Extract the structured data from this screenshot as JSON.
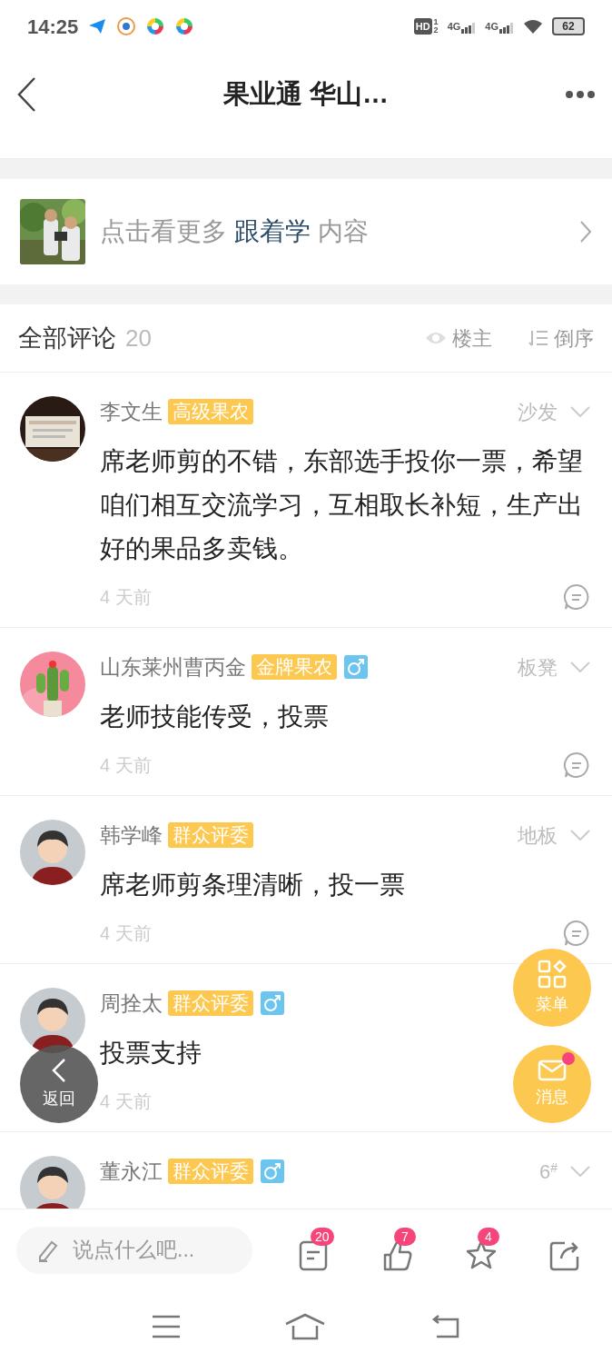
{
  "status_bar": {
    "time": "14:25",
    "hd": {
      "label": "HD",
      "sims": [
        "1",
        "2"
      ]
    },
    "networks": [
      "4G",
      "4G"
    ],
    "battery": "62"
  },
  "nav": {
    "title": "果业通 华山…"
  },
  "promo": {
    "prefix": "点击看更多",
    "highlight": "跟着学",
    "suffix": "内容"
  },
  "comments_header": {
    "title": "全部评论",
    "count": "20",
    "filters": [
      {
        "kind": "eye",
        "label": "楼主"
      },
      {
        "kind": "sort",
        "label": "倒序"
      }
    ]
  },
  "comments": [
    {
      "name": "李文生",
      "badge": "高级果农",
      "male": false,
      "floor": "沙发",
      "text": "席老师剪的不错，东部选手投你一票，希望咱们相互交流学习，互相取长补短，生产出好的果品多卖钱。",
      "time": "4 天前"
    },
    {
      "name": "山东莱州曹丙金",
      "badge": "金牌果农",
      "male": true,
      "floor": "板凳",
      "text": "老师技能传受，投票",
      "time": "4 天前"
    },
    {
      "avatar": {
        "kind": "default"
      },
      "name": "韩学峰",
      "badge": "群众评委",
      "male": false,
      "floor": "地板",
      "text": "席老师剪条理清晰，投一票",
      "time": "4 天前"
    },
    {
      "avatar": {
        "kind": "default"
      },
      "name": "周拴太",
      "badge": "群众评委",
      "male": true,
      "text": "投票支持",
      "time": "4 天前"
    },
    {
      "avatar": {
        "kind": "default"
      },
      "name": "董永江",
      "badge": "群众评委",
      "male": true,
      "floor": "6",
      "floor_sup": "#"
    }
  ],
  "floating": {
    "menu": "菜单",
    "messages": {
      "label": "消息",
      "unread": true
    },
    "back": "返回"
  },
  "bottom_bar": {
    "placeholder": "说点什么吧...",
    "actions": [
      {
        "kind": "comments",
        "badge": "20"
      },
      {
        "kind": "like",
        "badge": "7"
      },
      {
        "kind": "star",
        "badge": "4"
      },
      {
        "kind": "share"
      }
    ]
  }
}
